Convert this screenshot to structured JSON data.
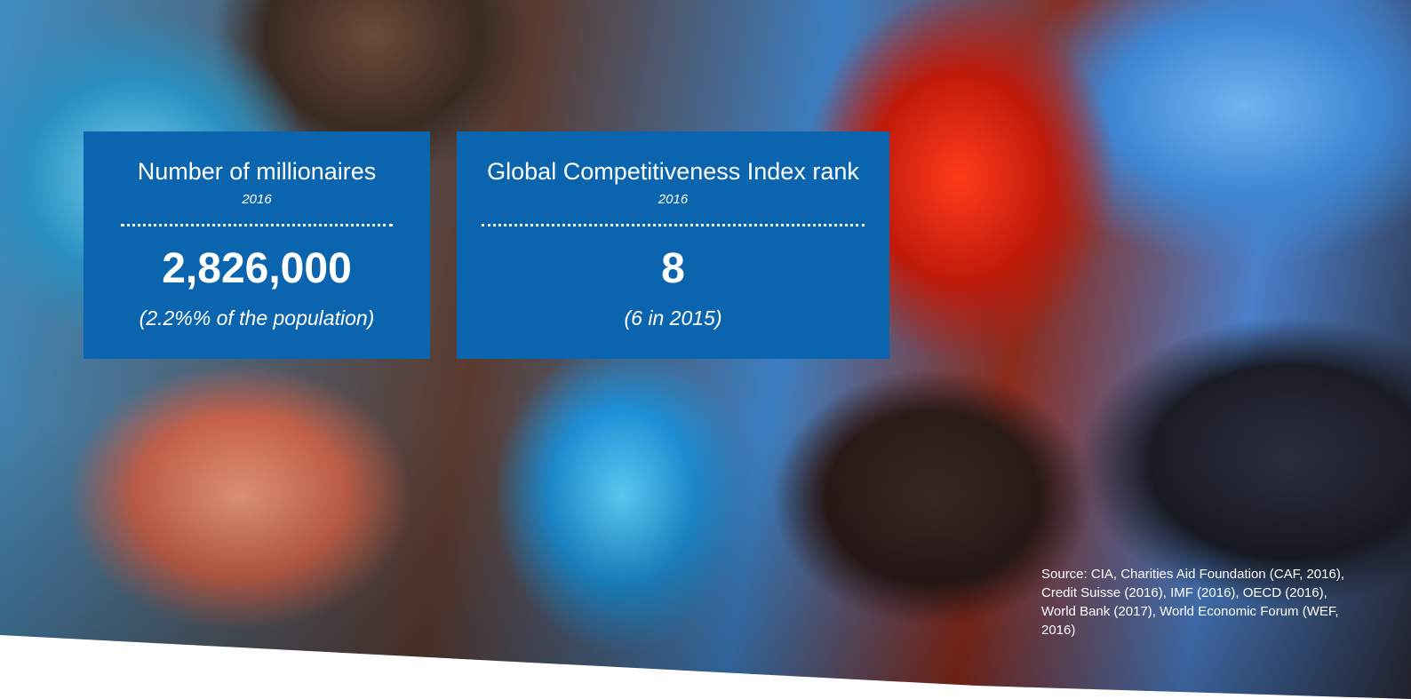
{
  "cards": [
    {
      "title": "Number of millionaires",
      "year": "2016",
      "value": "2,826,000",
      "note": "(2.2%% of the population)"
    },
    {
      "title": "Global Competitiveness Index rank",
      "year": "2016",
      "value": "8",
      "note": "(6 in 2015)"
    }
  ],
  "source": "Source: CIA, Charities Aid Foundation (CAF, 2016), Credit Suisse (2016), IMF (2016), OECD (2016), World Bank (2017), World Economic Forum (WEF, 2016)",
  "colors": {
    "card_background": "#0b65ae",
    "text": "#ffffff"
  }
}
